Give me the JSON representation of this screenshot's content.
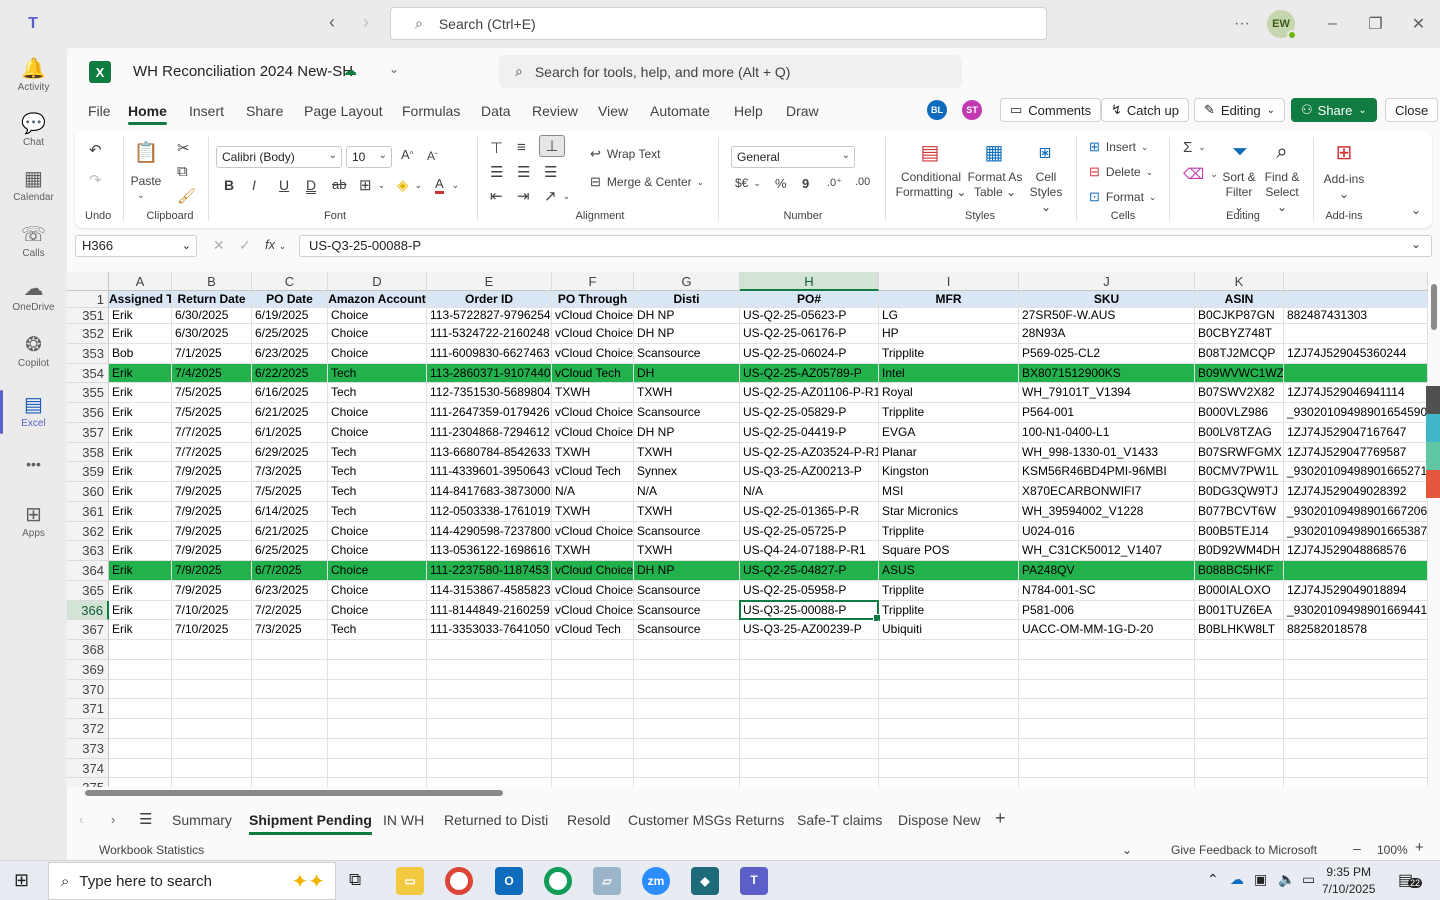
{
  "teams": {
    "search_placeholder": "Search (Ctrl+E)",
    "user_initials": "EW"
  },
  "rail": [
    {
      "label": "Activity",
      "icon": "bell-icon",
      "glyph": "🔔"
    },
    {
      "label": "Chat",
      "icon": "chat-icon",
      "glyph": "💬"
    },
    {
      "label": "Calendar",
      "icon": "calendar-icon",
      "glyph": "▦"
    },
    {
      "label": "Calls",
      "icon": "phone-icon",
      "glyph": "☏"
    },
    {
      "label": "OneDrive",
      "icon": "cloud-icon",
      "glyph": "☁"
    },
    {
      "label": "Copilot",
      "icon": "copilot-icon",
      "glyph": "❂"
    },
    {
      "label": "Excel",
      "icon": "excel-icon",
      "glyph": "▤"
    },
    {
      "label": "",
      "icon": "more-icon",
      "glyph": "•••"
    },
    {
      "label": "Apps",
      "icon": "apps-plus-icon",
      "glyph": "⊞"
    }
  ],
  "excel": {
    "workbook_name": "WH Reconciliation 2024 New-SH",
    "tool_search": "Search for tools, help, and more (Alt + Q)",
    "menu": [
      "File",
      "Home",
      "Insert",
      "Share",
      "Page Layout",
      "Formulas",
      "Data",
      "Review",
      "View",
      "Automate",
      "Help",
      "Draw"
    ],
    "active_menu": "Home",
    "collaborators": [
      {
        "initials": "BL",
        "color": "#0f6cbd"
      },
      {
        "initials": "ST",
        "color": "#c239b3"
      }
    ],
    "comments": "Comments",
    "catchup": "Catch up",
    "editing": "Editing",
    "share": "Share",
    "close": "Close"
  },
  "ribbon": {
    "undo_group": "Undo",
    "paste": "Paste",
    "clipboard_group": "Clipboard",
    "font_name": "Calibri (Body)",
    "font_size": "10",
    "font_group": "Font",
    "wrap_text": "Wrap Text",
    "merge_center": "Merge & Center",
    "alignment_group": "Alignment",
    "number_format": "General",
    "currency": "$€",
    "percent": "%",
    "comma": "9",
    "number_group": "Number",
    "conditional_formatting": [
      "Conditional",
      "Formatting"
    ],
    "format_as_table": [
      "Format As",
      "Table"
    ],
    "cell_styles": [
      "Cell",
      "Styles"
    ],
    "styles_group": "Styles",
    "insert": "Insert",
    "delete": "Delete",
    "format": "Format",
    "cells_group": "Cells",
    "sort_filter": [
      "Sort &",
      "Filter"
    ],
    "find_select": [
      "Find &",
      "Select"
    ],
    "editing_group": "Editing",
    "addins": "Add-ins",
    "addins_group": "Add-ins"
  },
  "formula": {
    "cell_ref": "H366",
    "value": "US-Q3-25-00088-P"
  },
  "columns": [
    {
      "letter": "A",
      "width": 63
    },
    {
      "letter": "B",
      "width": 80
    },
    {
      "letter": "C",
      "width": 76
    },
    {
      "letter": "D",
      "width": 99
    },
    {
      "letter": "E",
      "width": 125
    },
    {
      "letter": "F",
      "width": 82
    },
    {
      "letter": "G",
      "width": 106
    },
    {
      "letter": "H",
      "width": 139
    },
    {
      "letter": "I",
      "width": 140
    },
    {
      "letter": "J",
      "width": 176
    },
    {
      "letter": "K",
      "width": 89
    },
    {
      "letter": "",
      "width": 144
    }
  ],
  "selected_column": "H",
  "header_row": {
    "num": "1",
    "cells": [
      "Assigned To",
      "Return Date",
      "PO Date",
      "Amazon Account",
      "Order ID",
      "PO Through",
      "Disti",
      "PO#",
      "MFR",
      "SKU",
      "ASIN",
      ""
    ]
  },
  "rows": [
    {
      "num": "351",
      "cells": [
        "Erik",
        "6/30/2025",
        "6/19/2025",
        "Choice",
        "113-5722827-9796254",
        "vCloud Choice",
        "DH NP",
        "US-Q2-25-05623-P",
        "LG",
        "27SR50F-W.AUS",
        "B0CJKP87GN",
        "882487431303"
      ]
    },
    {
      "num": "352",
      "cells": [
        "Erik",
        "6/30/2025",
        "6/25/2025",
        "Choice",
        "111-5324722-2160248",
        "vCloud Choice",
        "DH NP",
        "US-Q2-25-06176-P",
        "HP",
        "28N93A",
        "B0CBYZ748T",
        ""
      ]
    },
    {
      "num": "353",
      "cells": [
        "Bob",
        "7/1/2025",
        "6/23/2025",
        "Choice",
        "111-6009830-6627463",
        "vCloud Choice",
        "Scansource",
        "US-Q2-25-06024-P",
        "Tripplite",
        "P569-025-CL2",
        "B08TJ2MCQP",
        "1ZJ74J529045360244"
      ]
    },
    {
      "num": "354",
      "hl": true,
      "cells": [
        "Erik",
        "7/4/2025",
        "6/22/2025",
        "Tech",
        "113-2860371-9107440",
        "vCloud Tech",
        "DH",
        "US-Q2-25-AZ05789-P",
        "Intel",
        "BX8071512900KS",
        "B09WVWC1WZ",
        ""
      ]
    },
    {
      "num": "355",
      "cells": [
        "Erik",
        "7/5/2025",
        "6/16/2025",
        "Tech",
        "112-7351530-5689804",
        "TXWH",
        "TXWH",
        "US-Q2-25-AZ01106-P-R1",
        "Royal",
        "WH_79101T_V1394",
        "B07SWV2X82",
        "1ZJ74J529046941114"
      ]
    },
    {
      "num": "356",
      "cells": [
        "Erik",
        "7/5/2025",
        "6/21/2025",
        "Choice",
        "111-2647359-0179426",
        "vCloud Choice",
        "Scansource",
        "US-Q2-25-05829-P",
        "Tripplite",
        "P564-001",
        "B000VLZ986",
        "_930201094989016545906"
      ]
    },
    {
      "num": "357",
      "cells": [
        "Erik",
        "7/7/2025",
        "6/1/2025",
        "Choice",
        "111-2304868-7294612",
        "vCloud Choice",
        "DH NP",
        "US-Q2-25-04419-P",
        "EVGA",
        "100-N1-0400-L1",
        "B00LV8TZAG",
        "1ZJ74J529047167647"
      ]
    },
    {
      "num": "358",
      "cells": [
        "Erik",
        "7/7/2025",
        "6/29/2025",
        "Tech",
        "113-6680784-8542633",
        "TXWH",
        "TXWH",
        "US-Q2-25-AZ03524-P-R1",
        "Planar",
        "WH_998-1330-01_V1433",
        "B07SRWFGMX",
        "1ZJ74J529047769587"
      ]
    },
    {
      "num": "359",
      "cells": [
        "Erik",
        "7/9/2025",
        "7/3/2025",
        "Tech",
        "111-4339601-3950643",
        "vCloud Tech",
        "Synnex",
        "US-Q3-25-AZ00213-P",
        "Kingston",
        "KSM56R46BD4PMI-96MBI",
        "B0CMV7PW1L",
        "_930201094989016652713"
      ]
    },
    {
      "num": "360",
      "cells": [
        "Erik",
        "7/9/2025",
        "7/5/2025",
        "Tech",
        "114-8417683-3873000",
        "N/A",
        "N/A",
        "N/A",
        "MSI",
        "X870ECARBONWIFI7",
        "B0DG3QW9TJ",
        "1ZJ74J529049028392"
      ]
    },
    {
      "num": "361",
      "cells": [
        "Erik",
        "7/9/2025",
        "6/14/2025",
        "Tech",
        "112-0503338-1761019",
        "TXWH",
        "TXWH",
        "US-Q2-25-01365-P-R",
        "Star Micronics",
        "WH_39594002_V1228",
        "B077BCVT6W",
        "_930201094989016672063"
      ]
    },
    {
      "num": "362",
      "cells": [
        "Erik",
        "7/9/2025",
        "6/21/2025",
        "Choice",
        "114-4290598-7237800",
        "vCloud Choice",
        "Scansource",
        "US-Q2-25-05725-P",
        "Tripplite",
        "U024-016",
        "B00B5TEJ14",
        "_930201094989016653879"
      ]
    },
    {
      "num": "363",
      "cells": [
        "Erik",
        "7/9/2025",
        "6/25/2025",
        "Choice",
        "113-0536122-1698616",
        "TXWH",
        "TXWH",
        "US-Q4-24-07188-P-R1",
        "Square POS",
        "WH_C31CK50012_V1407",
        "B0D92WM4DH",
        "1ZJ74J529048868576"
      ]
    },
    {
      "num": "364",
      "hl": true,
      "cells": [
        "Erik",
        "7/9/2025",
        "6/7/2025",
        "Choice",
        "111-2237580-1187453",
        "vCloud Choice",
        "DH NP",
        "US-Q2-25-04827-P",
        "ASUS",
        "PA248QV",
        "B088BC5HKF",
        ""
      ]
    },
    {
      "num": "365",
      "cells": [
        "Erik",
        "7/9/2025",
        "6/23/2025",
        "Choice",
        "114-3153867-4585823",
        "vCloud Choice",
        "Scansource",
        "US-Q2-25-05958-P",
        "Tripplite",
        "N784-001-SC",
        "B000IALOXO",
        "1ZJ74J529049018894"
      ]
    },
    {
      "num": "366",
      "sel": true,
      "cells": [
        "Erik",
        "7/10/2025",
        "7/2/2025",
        "Choice",
        "111-8144849-2160259",
        "vCloud Choice",
        "Scansource",
        "US-Q3-25-00088-P",
        "Tripplite",
        "P581-006",
        "B001TUZ6EA",
        "_930201094989016694416"
      ]
    },
    {
      "num": "367",
      "cells": [
        "Erik",
        "7/10/2025",
        "7/3/2025",
        "Tech",
        "111-3353033-7641050",
        "vCloud Tech",
        "Scansource",
        "US-Q3-25-AZ00239-P",
        "Ubiquiti",
        "UACC-OM-MM-1G-D-20",
        "B0BLHKW8LT",
        "882582018578"
      ]
    },
    {
      "num": "368",
      "cells": []
    },
    {
      "num": "369",
      "cells": []
    },
    {
      "num": "370",
      "cells": []
    },
    {
      "num": "371",
      "cells": []
    },
    {
      "num": "372",
      "cells": []
    },
    {
      "num": "373",
      "cells": []
    },
    {
      "num": "374",
      "cells": []
    },
    {
      "num": "375",
      "cells": []
    }
  ],
  "sheets": [
    "Summary",
    "Shipment Pending",
    "IN WH",
    "Returned to Disti",
    "Resold",
    "Customer MSGs Returns",
    "Safe-T claims",
    "Dispose New"
  ],
  "active_sheet": "Shipment Pending",
  "status": {
    "left": "Workbook Statistics",
    "feedback": "Give Feedback to Microsoft",
    "zoom": "100%"
  },
  "taskbar": {
    "search_placeholder": "Type here to search",
    "time": "9:35 PM",
    "date": "7/10/2025",
    "notifications": "22"
  },
  "colors": {
    "excel_green": "#107c41",
    "highlight_row": "#22b14c",
    "header_fill": "#d9e7f5",
    "teams_purple": "#5b5fc7"
  }
}
